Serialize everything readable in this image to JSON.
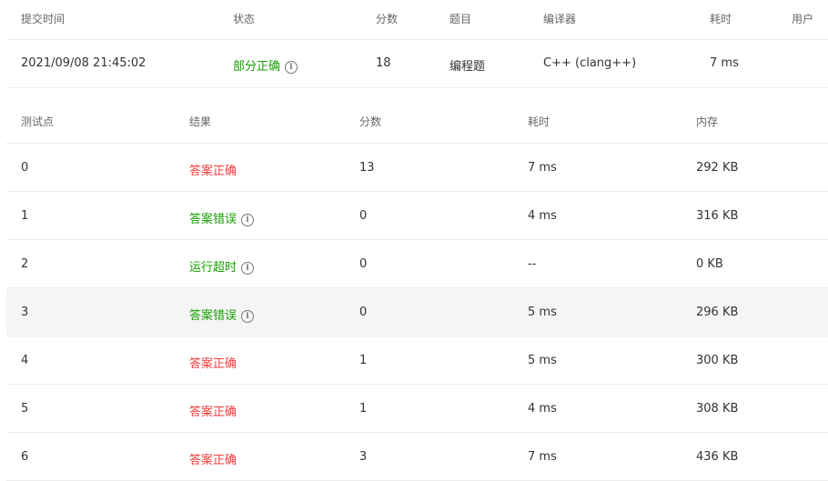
{
  "submission": {
    "headers": [
      "提交时间",
      "状态",
      "分数",
      "题目",
      "编译器",
      "耗时",
      "用户"
    ],
    "row": {
      "time": "2021/09/08 21:45:02",
      "status": "部分正确",
      "score": "18",
      "problem": "编程题",
      "compiler": "C++ (clang++)",
      "duration": "7 ms",
      "user": ""
    }
  },
  "cases": {
    "headers": [
      "测试点",
      "结果",
      "分数",
      "耗时",
      "内存"
    ],
    "rows": [
      {
        "id": "0",
        "result": "答案正确",
        "type": "red",
        "info": false,
        "score": "13",
        "time": "7 ms",
        "mem": "292 KB"
      },
      {
        "id": "1",
        "result": "答案错误",
        "type": "green",
        "info": true,
        "score": "0",
        "time": "4 ms",
        "mem": "316 KB"
      },
      {
        "id": "2",
        "result": "运行超时",
        "type": "green",
        "info": true,
        "score": "0",
        "time": "--",
        "mem": "0 KB"
      },
      {
        "id": "3",
        "result": "答案错误",
        "type": "green",
        "info": true,
        "score": "0",
        "time": "5 ms",
        "mem": "296 KB"
      },
      {
        "id": "4",
        "result": "答案正确",
        "type": "red",
        "info": false,
        "score": "1",
        "time": "5 ms",
        "mem": "300 KB"
      },
      {
        "id": "5",
        "result": "答案正确",
        "type": "red",
        "info": false,
        "score": "1",
        "time": "4 ms",
        "mem": "308 KB"
      },
      {
        "id": "6",
        "result": "答案正确",
        "type": "red",
        "info": false,
        "score": "3",
        "time": "7 ms",
        "mem": "436 KB"
      }
    ]
  },
  "colors": {
    "green": "#15a000",
    "red": "#f43a3a",
    "hover": "#f5f5f5"
  }
}
